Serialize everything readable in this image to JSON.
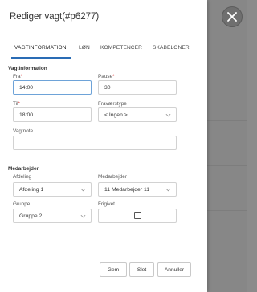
{
  "modal": {
    "title": "Rediger vagt(#p6277)"
  },
  "tabs": [
    {
      "label": "VAGTINFORMATION",
      "active": true
    },
    {
      "label": "LØN"
    },
    {
      "label": "KOMPETENCER"
    },
    {
      "label": "SKABELONER"
    }
  ],
  "vagtinformation": {
    "section_title": "Vagtinformation",
    "fra": {
      "label": "Fra",
      "required_mark": "*",
      "value": "14:00"
    },
    "pause": {
      "label": "Pause",
      "required_mark": "*",
      "value": "30"
    },
    "til": {
      "label": "Til",
      "required_mark": "*",
      "value": "18:00"
    },
    "fravaerstype": {
      "label": "Fraværstype",
      "value": "< Ingen >"
    },
    "vagtnote": {
      "label": "Vagtnote",
      "value": ""
    }
  },
  "medarbejder": {
    "section_title": "Medarbejder",
    "afdeling": {
      "label": "Afdeling",
      "value": "Afdeling 1"
    },
    "medarbejder": {
      "label": "Medarbejder",
      "value": "11 Medarbejder 11"
    },
    "gruppe": {
      "label": "Gruppe",
      "value": "Gruppe 2"
    },
    "frigivet": {
      "label": "Frigivet",
      "checked": false
    }
  },
  "footer": {
    "gem": "Gem",
    "slet": "Slet",
    "annuller": "Annuller"
  },
  "icons": {
    "close": "close-icon",
    "select": "chevron-down-icon"
  },
  "colors": {
    "accent": "#2a6cb5",
    "required": "#d33333",
    "backdrop": "#8f8f8f"
  }
}
